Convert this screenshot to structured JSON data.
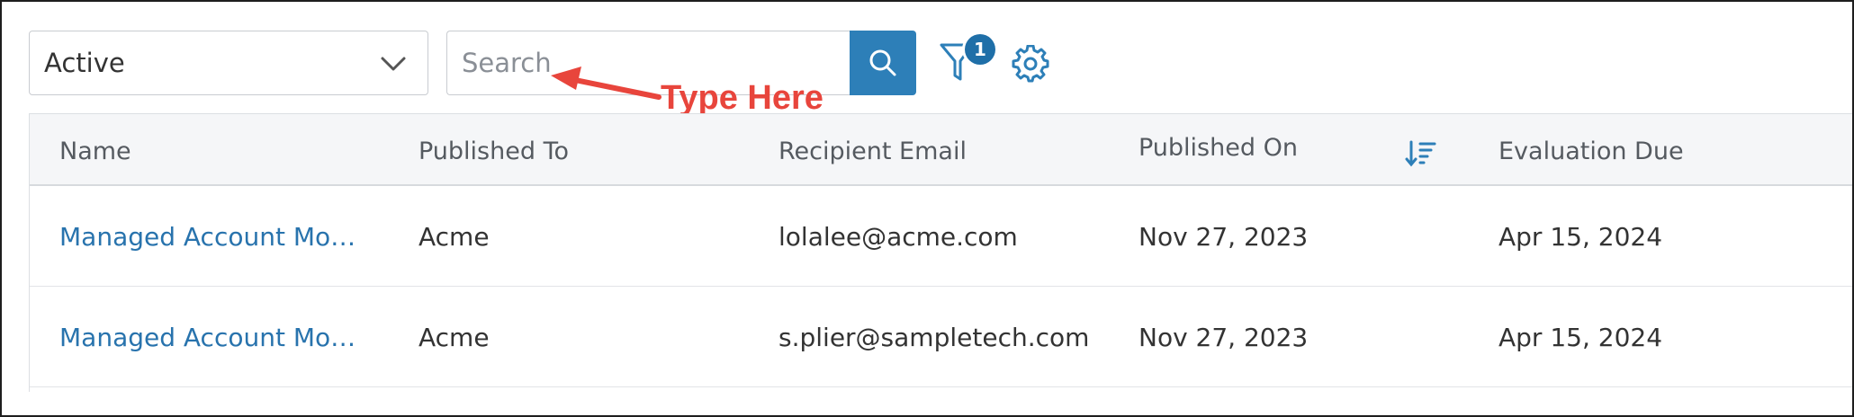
{
  "toolbar": {
    "status_value": "Active",
    "search_placeholder": "Search",
    "search_value": "",
    "filter_count": "1"
  },
  "annotation": {
    "text": "Type Here",
    "color": "#e8453c"
  },
  "table": {
    "columns": [
      "Name",
      "Published To",
      "Recipient Email",
      "Published On",
      "Evaluation Due"
    ],
    "rows": [
      {
        "name": "Managed Account Model",
        "published_to": "Acme",
        "recipient_email": "lolalee@acme.com",
        "published_on": "Nov 27, 2023",
        "evaluation_due": "Apr 15, 2024"
      },
      {
        "name": "Managed Account Model",
        "published_to": "Acme",
        "recipient_email": "s.plier@sampletech.com",
        "published_on": "Nov 27, 2023",
        "evaluation_due": "Apr 15, 2024"
      }
    ]
  },
  "colors": {
    "accent": "#2d7fb8",
    "link": "#2873ad",
    "header_bg": "#f5f6f8"
  },
  "icons": {
    "select": "chevron-down-icon",
    "search": "search-icon",
    "filter": "filter-icon",
    "settings": "gear-icon",
    "sort": "sort-descending-icon"
  }
}
